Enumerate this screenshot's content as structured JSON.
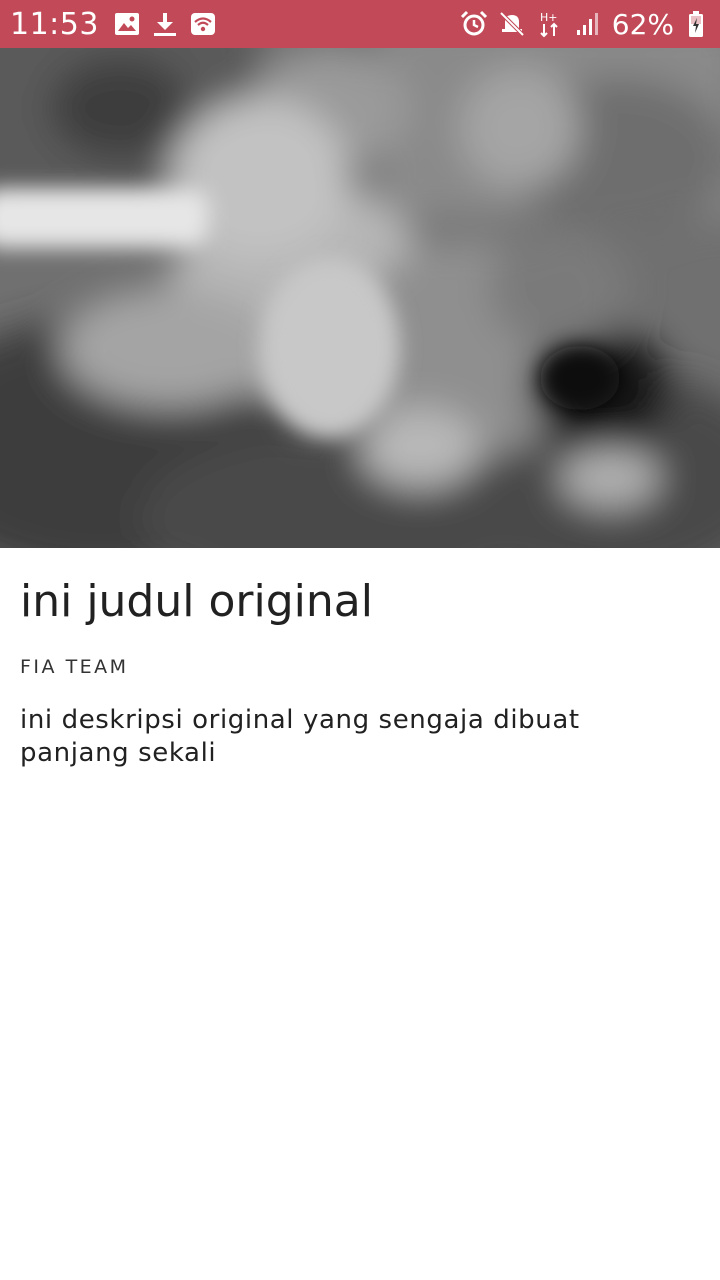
{
  "status_bar": {
    "time": "11:53",
    "battery_percent": "62%",
    "battery_level": 0.62,
    "background_color": "#c24a58",
    "left_icons": [
      "image-icon",
      "download-icon",
      "wifi-hotspot-icon"
    ],
    "right_icons": [
      "alarm-icon",
      "mute-icon",
      "data-transfer-icon",
      "signal-icon",
      "battery-icon"
    ]
  },
  "article": {
    "title": "ini judul original",
    "author": "FIA TEAM",
    "description": "ini deskripsi original yang sengaja dibuat panjang sekali"
  },
  "colors": {
    "text_primary": "#212121",
    "background": "#ffffff"
  }
}
